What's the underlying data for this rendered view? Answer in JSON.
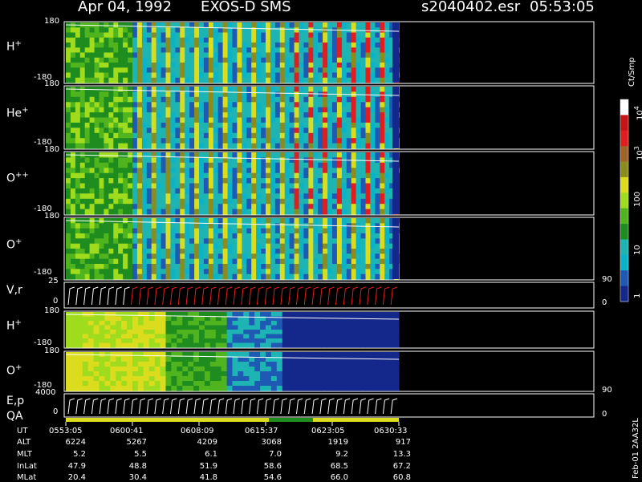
{
  "header": {
    "date": "Apr 04, 1992",
    "instrument": "EXOS-D SMS",
    "file": "s2040402.esr",
    "time": "05:53:05"
  },
  "panels": [
    {
      "label": "H",
      "charge": "+",
      "top_tick": "180",
      "bottom_tick": "-180"
    },
    {
      "label": "He",
      "charge": "+",
      "top_tick": "180",
      "bottom_tick": "-180"
    },
    {
      "label": "O",
      "charge": "++",
      "top_tick": "180",
      "bottom_tick": "-180"
    },
    {
      "label": "O",
      "charge": "+",
      "top_tick": "180",
      "bottom_tick": "-180"
    },
    {
      "label": "V,r",
      "charge": "",
      "top_tick": "25",
      "bottom_tick": "0",
      "right_top": "90",
      "right_bottom": "0"
    },
    {
      "label": "H",
      "charge": "+",
      "top_tick": "180",
      "bottom_tick": "-180"
    },
    {
      "label": "O",
      "charge": "+",
      "top_tick": "180",
      "bottom_tick": "-180"
    },
    {
      "label": "E,p",
      "charge": "",
      "top_tick": "4000",
      "bottom_tick": "0",
      "right_top": "90",
      "right_bottom": "0"
    }
  ],
  "qa_label": "QA",
  "colorbar": {
    "unit": "Ct/Smp",
    "ticks": [
      "10",
      "10",
      "100",
      "10",
      "1"
    ],
    "tick_exponents": [
      "4",
      "3",
      "",
      "",
      ""
    ],
    "colors": [
      "#ffffff",
      "#c81414",
      "#e01e1e",
      "#a06428",
      "#8c8c1e",
      "#dcdc1e",
      "#a0dc1e",
      "#50b41e",
      "#1e8c1e",
      "#1eb4b4",
      "#0ab4c8",
      "#1e5ab4",
      "#14288c"
    ]
  },
  "footer": {
    "row_labels": [
      "UT",
      "ALT",
      "MLT",
      "InLat",
      "MLat"
    ],
    "columns": [
      [
        "0553:05",
        "6224",
        "5.2",
        "47.9",
        "20.4"
      ],
      [
        "0600:41",
        "5267",
        "5.5",
        "48.8",
        "30.4"
      ],
      [
        "0608:09",
        "4209",
        "6.1",
        "51.9",
        "41.8"
      ],
      [
        "0615:37",
        "3068",
        "7.0",
        "58.6",
        "54.6"
      ],
      [
        "0623:05",
        "1919",
        "9.2",
        "68.5",
        "66.0"
      ],
      [
        "0630:33",
        "917",
        "13.3",
        "67.2",
        "60.8"
      ]
    ],
    "stamp": "Feb-01 2AA32L"
  },
  "chart_data": {
    "type": "heatmap",
    "title": "Apr 04, 1992    EXOS-D SMS",
    "x_label": "UT",
    "x_ticks": [
      "0553:05",
      "0600:41",
      "0608:09",
      "0615:37",
      "0623:05",
      "0630:33"
    ],
    "series": [
      {
        "name": "H+",
        "y_range": [
          -180,
          180
        ]
      },
      {
        "name": "He+",
        "y_range": [
          -180,
          180
        ]
      },
      {
        "name": "O++",
        "y_range": [
          -180,
          180
        ]
      },
      {
        "name": "O+",
        "y_range": [
          -180,
          180
        ]
      },
      {
        "name": "V,r",
        "y_range": [
          0,
          25
        ]
      },
      {
        "name": "H+",
        "y_range": [
          -180,
          180
        ]
      },
      {
        "name": "O+",
        "y_range": [
          -180,
          180
        ]
      },
      {
        "name": "E,p",
        "y_range": [
          0,
          4000
        ]
      }
    ],
    "color_scale": "log",
    "color_range": [
      1,
      10000
    ],
    "color_unit": "Ct/Smp"
  }
}
